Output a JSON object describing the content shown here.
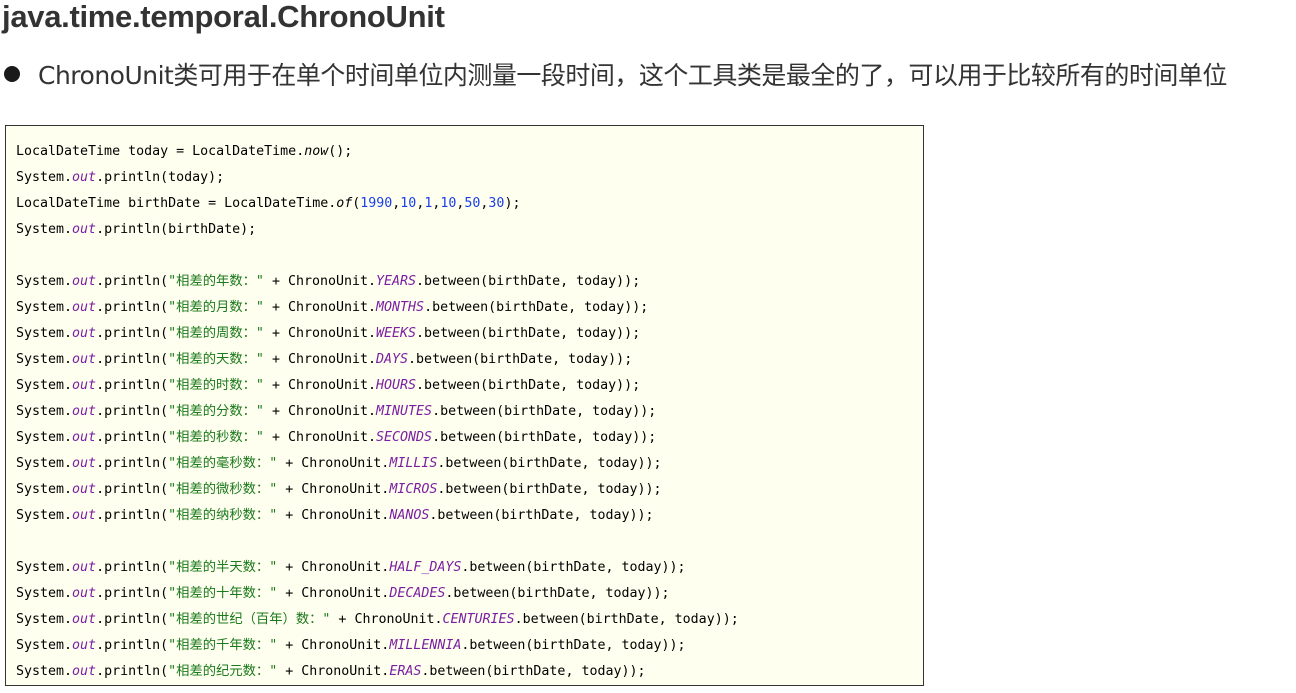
{
  "header": {
    "title": "java.time.temporal.ChronoUnit"
  },
  "bullet": {
    "text": "ChronoUnit类可用于在单个时间单位内测量一段时间，这个工具类是最全的了，可以用于比较所有的时间单位"
  },
  "code": {
    "lines": [
      [
        {
          "t": "LocalDateTime today = LocalDateTime.",
          "k": "plain"
        },
        {
          "t": "now",
          "k": "method"
        },
        {
          "t": "();",
          "k": "plain"
        }
      ],
      [
        {
          "t": "System.",
          "k": "plain"
        },
        {
          "t": "out",
          "k": "field"
        },
        {
          "t": ".println(today);",
          "k": "plain"
        }
      ],
      [
        {
          "t": "LocalDateTime birthDate = LocalDateTime.",
          "k": "plain"
        },
        {
          "t": "of",
          "k": "method"
        },
        {
          "t": "(",
          "k": "plain"
        },
        {
          "t": "1990",
          "k": "number"
        },
        {
          "t": ",",
          "k": "plain"
        },
        {
          "t": "10",
          "k": "number"
        },
        {
          "t": ",",
          "k": "plain"
        },
        {
          "t": "1",
          "k": "number"
        },
        {
          "t": ",",
          "k": "plain"
        },
        {
          "t": "10",
          "k": "number"
        },
        {
          "t": ",",
          "k": "plain"
        },
        {
          "t": "50",
          "k": "number"
        },
        {
          "t": ",",
          "k": "plain"
        },
        {
          "t": "30",
          "k": "number"
        },
        {
          "t": ");",
          "k": "plain"
        }
      ],
      [
        {
          "t": "System.",
          "k": "plain"
        },
        {
          "t": "out",
          "k": "field"
        },
        {
          "t": ".println(birthDate);",
          "k": "plain"
        }
      ],
      [],
      [
        {
          "t": "System.",
          "k": "plain"
        },
        {
          "t": "out",
          "k": "field"
        },
        {
          "t": ".println(",
          "k": "plain"
        },
        {
          "t": "\"相差的年数：\"",
          "k": "string"
        },
        {
          "t": " + ChronoUnit.",
          "k": "plain"
        },
        {
          "t": "YEARS",
          "k": "field"
        },
        {
          "t": ".between(birthDate, today));",
          "k": "plain"
        }
      ],
      [
        {
          "t": "System.",
          "k": "plain"
        },
        {
          "t": "out",
          "k": "field"
        },
        {
          "t": ".println(",
          "k": "plain"
        },
        {
          "t": "\"相差的月数：\"",
          "k": "string"
        },
        {
          "t": " + ChronoUnit.",
          "k": "plain"
        },
        {
          "t": "MONTHS",
          "k": "field"
        },
        {
          "t": ".between(birthDate, today));",
          "k": "plain"
        }
      ],
      [
        {
          "t": "System.",
          "k": "plain"
        },
        {
          "t": "out",
          "k": "field"
        },
        {
          "t": ".println(",
          "k": "plain"
        },
        {
          "t": "\"相差的周数：\"",
          "k": "string"
        },
        {
          "t": " + ChronoUnit.",
          "k": "plain"
        },
        {
          "t": "WEEKS",
          "k": "field"
        },
        {
          "t": ".between(birthDate, today));",
          "k": "plain"
        }
      ],
      [
        {
          "t": "System.",
          "k": "plain"
        },
        {
          "t": "out",
          "k": "field"
        },
        {
          "t": ".println(",
          "k": "plain"
        },
        {
          "t": "\"相差的天数：\"",
          "k": "string"
        },
        {
          "t": " + ChronoUnit.",
          "k": "plain"
        },
        {
          "t": "DAYS",
          "k": "field"
        },
        {
          "t": ".between(birthDate, today));",
          "k": "plain"
        }
      ],
      [
        {
          "t": "System.",
          "k": "plain"
        },
        {
          "t": "out",
          "k": "field"
        },
        {
          "t": ".println(",
          "k": "plain"
        },
        {
          "t": "\"相差的时数：\"",
          "k": "string"
        },
        {
          "t": " + ChronoUnit.",
          "k": "plain"
        },
        {
          "t": "HOURS",
          "k": "field"
        },
        {
          "t": ".between(birthDate, today));",
          "k": "plain"
        }
      ],
      [
        {
          "t": "System.",
          "k": "plain"
        },
        {
          "t": "out",
          "k": "field"
        },
        {
          "t": ".println(",
          "k": "plain"
        },
        {
          "t": "\"相差的分数：\"",
          "k": "string"
        },
        {
          "t": " + ChronoUnit.",
          "k": "plain"
        },
        {
          "t": "MINUTES",
          "k": "field"
        },
        {
          "t": ".between(birthDate, today));",
          "k": "plain"
        }
      ],
      [
        {
          "t": "System.",
          "k": "plain"
        },
        {
          "t": "out",
          "k": "field"
        },
        {
          "t": ".println(",
          "k": "plain"
        },
        {
          "t": "\"相差的秒数：\"",
          "k": "string"
        },
        {
          "t": " + ChronoUnit.",
          "k": "plain"
        },
        {
          "t": "SECONDS",
          "k": "field"
        },
        {
          "t": ".between(birthDate, today));",
          "k": "plain"
        }
      ],
      [
        {
          "t": "System.",
          "k": "plain"
        },
        {
          "t": "out",
          "k": "field"
        },
        {
          "t": ".println(",
          "k": "plain"
        },
        {
          "t": "\"相差的毫秒数：\"",
          "k": "string"
        },
        {
          "t": " + ChronoUnit.",
          "k": "plain"
        },
        {
          "t": "MILLIS",
          "k": "field"
        },
        {
          "t": ".between(birthDate, today));",
          "k": "plain"
        }
      ],
      [
        {
          "t": "System.",
          "k": "plain"
        },
        {
          "t": "out",
          "k": "field"
        },
        {
          "t": ".println(",
          "k": "plain"
        },
        {
          "t": "\"相差的微秒数：\"",
          "k": "string"
        },
        {
          "t": " + ChronoUnit.",
          "k": "plain"
        },
        {
          "t": "MICROS",
          "k": "field"
        },
        {
          "t": ".between(birthDate, today));",
          "k": "plain"
        }
      ],
      [
        {
          "t": "System.",
          "k": "plain"
        },
        {
          "t": "out",
          "k": "field"
        },
        {
          "t": ".println(",
          "k": "plain"
        },
        {
          "t": "\"相差的纳秒数：\"",
          "k": "string"
        },
        {
          "t": " + ChronoUnit.",
          "k": "plain"
        },
        {
          "t": "NANOS",
          "k": "field"
        },
        {
          "t": ".between(birthDate, today));",
          "k": "plain"
        }
      ],
      [],
      [
        {
          "t": "System.",
          "k": "plain"
        },
        {
          "t": "out",
          "k": "field"
        },
        {
          "t": ".println(",
          "k": "plain"
        },
        {
          "t": "\"相差的半天数：\"",
          "k": "string"
        },
        {
          "t": " + ChronoUnit.",
          "k": "plain"
        },
        {
          "t": "HALF_DAYS",
          "k": "field"
        },
        {
          "t": ".between(birthDate, today));",
          "k": "plain"
        }
      ],
      [
        {
          "t": "System.",
          "k": "plain"
        },
        {
          "t": "out",
          "k": "field"
        },
        {
          "t": ".println(",
          "k": "plain"
        },
        {
          "t": "\"相差的十年数：\"",
          "k": "string"
        },
        {
          "t": " + ChronoUnit.",
          "k": "plain"
        },
        {
          "t": "DECADES",
          "k": "field"
        },
        {
          "t": ".between(birthDate, today));",
          "k": "plain"
        }
      ],
      [
        {
          "t": "System.",
          "k": "plain"
        },
        {
          "t": "out",
          "k": "field"
        },
        {
          "t": ".println(",
          "k": "plain"
        },
        {
          "t": "\"相差的世纪（百年）数：\"",
          "k": "string"
        },
        {
          "t": " + ChronoUnit.",
          "k": "plain"
        },
        {
          "t": "CENTURIES",
          "k": "field"
        },
        {
          "t": ".between(birthDate, today));",
          "k": "plain"
        }
      ],
      [
        {
          "t": "System.",
          "k": "plain"
        },
        {
          "t": "out",
          "k": "field"
        },
        {
          "t": ".println(",
          "k": "plain"
        },
        {
          "t": "\"相差的千年数：\"",
          "k": "string"
        },
        {
          "t": " + ChronoUnit.",
          "k": "plain"
        },
        {
          "t": "MILLENNIA",
          "k": "field"
        },
        {
          "t": ".between(birthDate, today));",
          "k": "plain"
        }
      ],
      [
        {
          "t": "System.",
          "k": "plain"
        },
        {
          "t": "out",
          "k": "field"
        },
        {
          "t": ".println(",
          "k": "plain"
        },
        {
          "t": "\"相差的纪元数：\"",
          "k": "string"
        },
        {
          "t": " + ChronoUnit.",
          "k": "plain"
        },
        {
          "t": "ERAS",
          "k": "field"
        },
        {
          "t": ".between(birthDate, today));",
          "k": "plain"
        }
      ]
    ]
  },
  "colors": {
    "code_background": "#fffff0",
    "field_color": "#7b1fa2",
    "string_color": "#1b7a1b",
    "number_color": "#1a3ee8"
  }
}
